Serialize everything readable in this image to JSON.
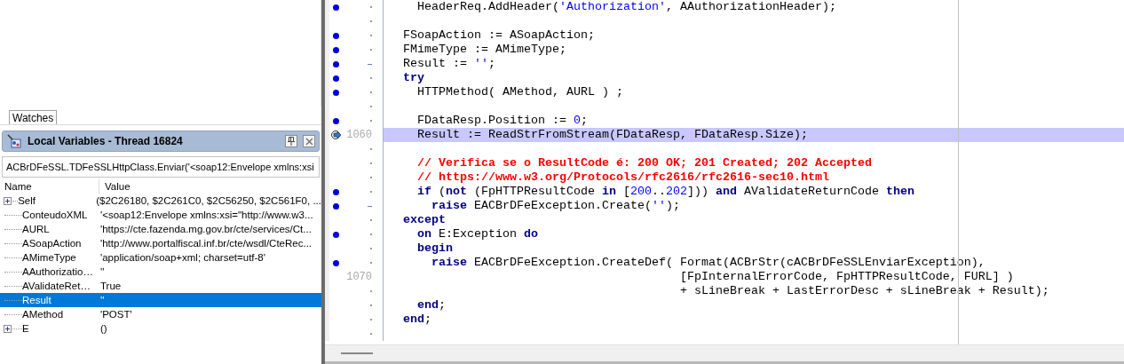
{
  "watches_tab": {
    "label": "Watches",
    "selected": true
  },
  "locals": {
    "title": "Local Variables - Thread 16824",
    "frame": "ACBrDFeSSL.TDFeSSLHttpClass.Enviar('<soap12:Envelope xmlns:xsi",
    "columns": [
      "Name",
      "Value"
    ],
    "rows": [
      {
        "name": "Self",
        "value": "($2C26180, $2C261C0, $2C56250, $2C561F0, ...",
        "expandable": true,
        "selected": false
      },
      {
        "name": "ConteudoXML",
        "value": "'<soap12:Envelope xmlns:xsi=\"http://www.w3...",
        "expandable": false,
        "selected": false
      },
      {
        "name": "AURL",
        "value": "'https://cte.fazenda.mg.gov.br/cte/services/Ct...",
        "expandable": false,
        "selected": false
      },
      {
        "name": "ASoapAction",
        "value": "'http://www.portalfiscal.inf.br/cte/wsdl/CteRec...",
        "expandable": false,
        "selected": false
      },
      {
        "name": "AMimeType",
        "value": "'application/soap+xml; charset=utf-8'",
        "expandable": false,
        "selected": false
      },
      {
        "name": "AAuthorizatio…",
        "value": "''",
        "expandable": false,
        "selected": false
      },
      {
        "name": "AValidateRet…",
        "value": "True",
        "expandable": false,
        "selected": false
      },
      {
        "name": "Result",
        "value": "''",
        "expandable": false,
        "selected": true
      },
      {
        "name": "AMethod",
        "value": "'POST'",
        "expandable": false,
        "selected": false
      },
      {
        "name": "E",
        "value": "()",
        "expandable": true,
        "selected": false
      }
    ]
  },
  "editor": {
    "lines": [
      {
        "breakpoint": true,
        "modified": false,
        "current": false,
        "segments": [
          {
            "kind": "plain",
            "text": "    HeaderReq.AddHeader("
          },
          {
            "kind": "string",
            "text": "'Authorization'"
          },
          {
            "kind": "plain",
            "text": ", AAuthorizationHeader);"
          }
        ]
      },
      {
        "breakpoint": false,
        "modified": false,
        "current": false
      },
      {
        "breakpoint": true,
        "modified": false,
        "current": false,
        "segments": [
          {
            "kind": "plain",
            "text": "  FSoapAction := ASoapAction;"
          }
        ]
      },
      {
        "breakpoint": true,
        "modified": false,
        "current": false,
        "segments": [
          {
            "kind": "plain",
            "text": "  FMimeType := AMimeType;"
          }
        ]
      },
      {
        "breakpoint": true,
        "modified": true,
        "current": false,
        "segments": [
          {
            "kind": "plain",
            "text": "  Result := "
          },
          {
            "kind": "string",
            "text": "''"
          },
          {
            "kind": "plain",
            "text": ";"
          }
        ]
      },
      {
        "breakpoint": true,
        "modified": false,
        "current": false,
        "segments": [
          {
            "kind": "keyword",
            "text": "  try"
          }
        ]
      },
      {
        "breakpoint": true,
        "modified": false,
        "current": false,
        "segments": [
          {
            "kind": "plain",
            "text": "    HTTPMethod( AMethod, AURL ) ;"
          }
        ]
      },
      {
        "breakpoint": false,
        "modified": false,
        "current": false
      },
      {
        "breakpoint": true,
        "modified": false,
        "current": false,
        "segments": [
          {
            "kind": "plain",
            "text": "    FDataResp.Position := "
          },
          {
            "kind": "number",
            "text": "0"
          },
          {
            "kind": "plain",
            "text": ";"
          }
        ]
      },
      {
        "number": "1060",
        "breakpoint": false,
        "modified": false,
        "current": true,
        "segments": [
          {
            "kind": "plain",
            "text": "    Result := ReadStrFromStream(FDataResp, FDataResp.Size);"
          }
        ]
      },
      {
        "breakpoint": false,
        "modified": false,
        "current": false
      },
      {
        "breakpoint": false,
        "modified": false,
        "current": false,
        "segments": [
          {
            "kind": "comment",
            "text": "    // Verifica se o ResultCode é: 200 OK; 201 Created; 202 Accepted"
          }
        ]
      },
      {
        "breakpoint": false,
        "modified": false,
        "current": false,
        "segments": [
          {
            "kind": "comment",
            "text": "    // https://www.w3.org/Protocols/rfc2616/rfc2616-sec10.html"
          }
        ]
      },
      {
        "breakpoint": true,
        "modified": false,
        "current": false,
        "segments": [
          {
            "kind": "keyword",
            "text": "    if"
          },
          {
            "kind": "plain",
            "text": " ("
          },
          {
            "kind": "keyword",
            "text": "not"
          },
          {
            "kind": "plain",
            "text": " (FpHTTPResultCode "
          },
          {
            "kind": "keyword",
            "text": "in"
          },
          {
            "kind": "plain",
            "text": " ["
          },
          {
            "kind": "number",
            "text": "200"
          },
          {
            "kind": "plain",
            "text": ".."
          },
          {
            "kind": "number",
            "text": "202"
          },
          {
            "kind": "plain",
            "text": "])) "
          },
          {
            "kind": "keyword",
            "text": "and"
          },
          {
            "kind": "plain",
            "text": " AValidateReturnCode "
          },
          {
            "kind": "keyword",
            "text": "then"
          }
        ]
      },
      {
        "breakpoint": true,
        "modified": true,
        "current": false,
        "segments": [
          {
            "kind": "keyword",
            "text": "      raise"
          },
          {
            "kind": "plain",
            "text": " EACBrDFeException.Create("
          },
          {
            "kind": "string",
            "text": "''"
          },
          {
            "kind": "plain",
            "text": ");"
          }
        ]
      },
      {
        "breakpoint": false,
        "modified": false,
        "current": false,
        "segments": [
          {
            "kind": "keyword",
            "text": "  except"
          }
        ]
      },
      {
        "breakpoint": true,
        "modified": false,
        "current": false,
        "segments": [
          {
            "kind": "keyword",
            "text": "    on"
          },
          {
            "kind": "plain",
            "text": " E:Exception "
          },
          {
            "kind": "keyword",
            "text": "do"
          }
        ]
      },
      {
        "breakpoint": false,
        "modified": false,
        "current": false,
        "segments": [
          {
            "kind": "keyword",
            "text": "    begin"
          }
        ]
      },
      {
        "breakpoint": true,
        "modified": false,
        "current": false,
        "segments": [
          {
            "kind": "keyword",
            "text": "      raise"
          },
          {
            "kind": "plain",
            "text": " EACBrDFeException.CreateDef( Format(ACBrStr(cACBrDFeSSLEnviarException),"
          }
        ]
      },
      {
        "number": "1070",
        "breakpoint": false,
        "modified": false,
        "current": false,
        "segments": [
          {
            "kind": "plain",
            "text": "                                         [FpInternalErrorCode, FpHTTPResultCode, FURL] )"
          }
        ]
      },
      {
        "breakpoint": false,
        "modified": false,
        "current": false,
        "segments": [
          {
            "kind": "plain",
            "text": "                                         + sLineBreak + LastErrorDesc + sLineBreak + Result);"
          }
        ]
      },
      {
        "breakpoint": false,
        "modified": false,
        "current": false,
        "segments": [
          {
            "kind": "keyword",
            "text": "    end"
          },
          {
            "kind": "plain",
            "text": ";"
          }
        ]
      },
      {
        "breakpoint": false,
        "modified": false,
        "current": false,
        "segments": [
          {
            "kind": "keyword",
            "text": "  end"
          },
          {
            "kind": "plain",
            "text": ";"
          }
        ]
      },
      {
        "breakpoint": false,
        "modified": false,
        "current": false
      }
    ]
  }
}
